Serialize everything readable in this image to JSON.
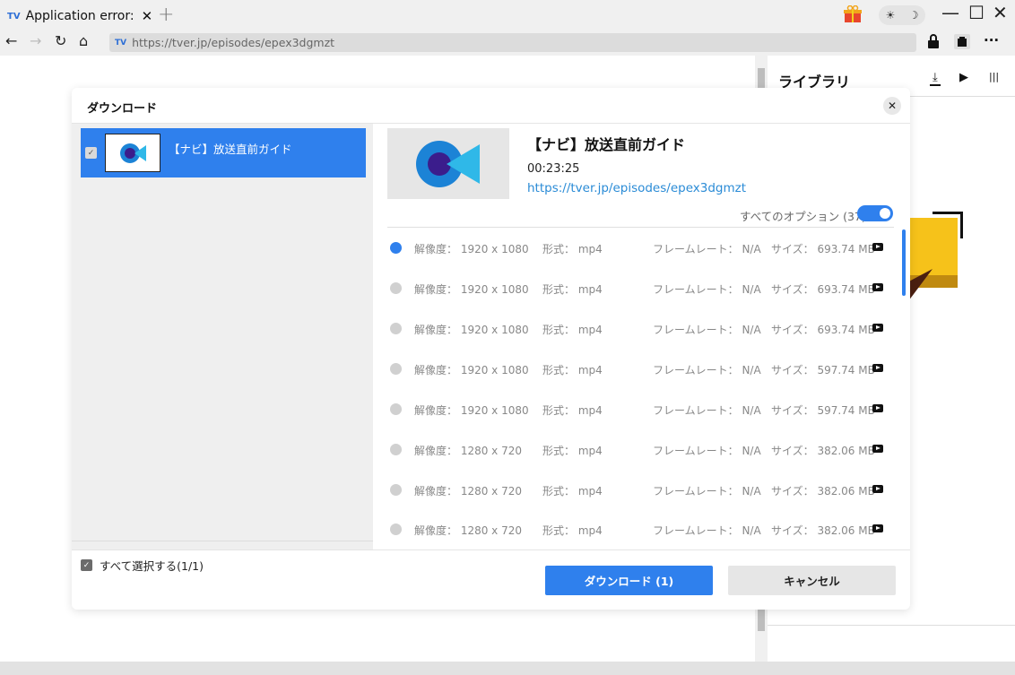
{
  "browser": {
    "tab_title": "Application error:",
    "tab_favicon": "TV",
    "tab_close": "✕",
    "new_tab": "+",
    "url": "https://tver.jp/episodes/epex3dgmzt",
    "theme_sun": "☀",
    "theme_moon": "☽",
    "more": "···"
  },
  "sidebar": {
    "title": "ライブラリ"
  },
  "dialog": {
    "title": "ダウンロード",
    "close": "✕",
    "item_label": "【ナビ】放送直前ガイド",
    "select_all": "すべて選択する(1/1)",
    "video_title": "【ナビ】放送直前ガイド",
    "duration": "00:23:25",
    "link": "https://tver.jp/episodes/epex3dgmzt",
    "all_options": "すべてのオプション (37)",
    "download_button": "ダウンロード (1)",
    "cancel_button": "キャンセル"
  },
  "options": [
    {
      "resolution": "解像度： 1920 x 1080",
      "format": "形式： mp4",
      "framerate": "フレームレート： N/A",
      "size": "サイズ： 693.74 MB",
      "selected": true
    },
    {
      "resolution": "解像度： 1920 x 1080",
      "format": "形式： mp4",
      "framerate": "フレームレート： N/A",
      "size": "サイズ： 693.74 MB",
      "selected": false
    },
    {
      "resolution": "解像度： 1920 x 1080",
      "format": "形式： mp4",
      "framerate": "フレームレート： N/A",
      "size": "サイズ： 693.74 MB",
      "selected": false
    },
    {
      "resolution": "解像度： 1920 x 1080",
      "format": "形式： mp4",
      "framerate": "フレームレート： N/A",
      "size": "サイズ： 597.74 MB",
      "selected": false
    },
    {
      "resolution": "解像度： 1920 x 1080",
      "format": "形式： mp4",
      "framerate": "フレームレート： N/A",
      "size": "サイズ： 597.74 MB",
      "selected": false
    },
    {
      "resolution": "解像度： 1280 x 720",
      "format": "形式： mp4",
      "framerate": "フレームレート： N/A",
      "size": "サイズ： 382.06 MB",
      "selected": false
    },
    {
      "resolution": "解像度： 1280 x 720",
      "format": "形式： mp4",
      "framerate": "フレームレート： N/A",
      "size": "サイズ： 382.06 MB",
      "selected": false
    },
    {
      "resolution": "解像度： 1280 x 720",
      "format": "形式： mp4",
      "framerate": "フレームレート： N/A",
      "size": "サイズ： 382.06 MB",
      "selected": false
    }
  ],
  "colors": {
    "accent": "#2f80ed",
    "link": "#2a8bd6"
  }
}
